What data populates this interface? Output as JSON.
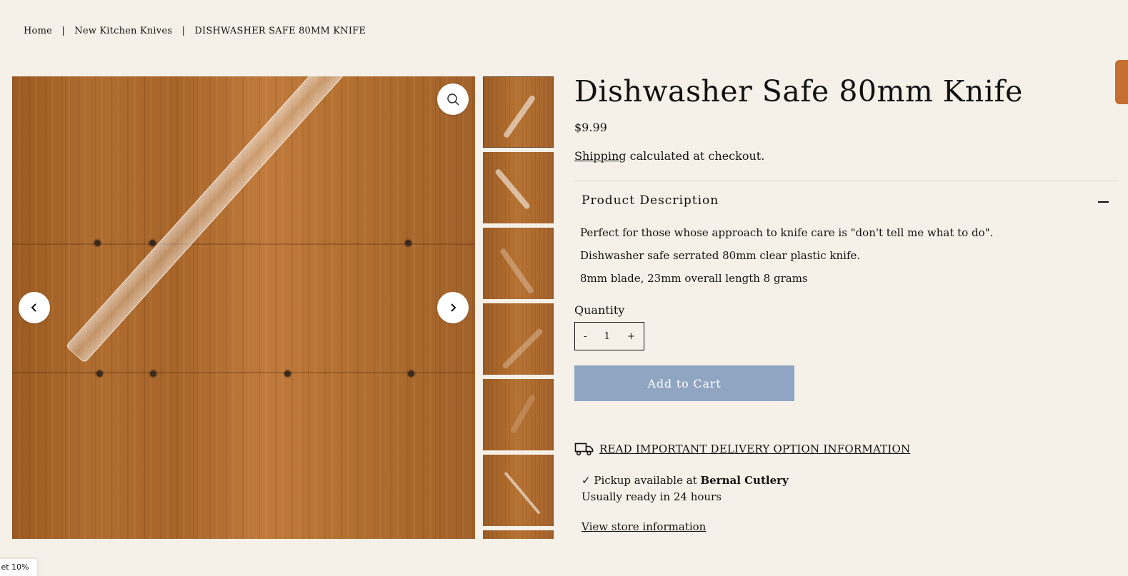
{
  "breadcrumb": {
    "home": "Home",
    "separator": "|",
    "category": "New Kitchen Knives",
    "current": "DISHWASHER SAFE 80MM KNIFE"
  },
  "gallery": {
    "zoom_icon": "magnifier-icon",
    "prev_icon": "chevron-left-icon",
    "next_icon": "chevron-right-icon",
    "thumbnail_count_visible": 7
  },
  "product": {
    "title": "Dishwasher Safe 80mm Knife",
    "price": "$9.99",
    "shipping_link": "Shipping",
    "shipping_text": " calculated at checkout."
  },
  "description": {
    "heading": "Product Description",
    "collapse_icon": "minus-icon",
    "lines": [
      "Perfect for those whose approach to knife care is \"don't tell me what to do\".",
      "Dishwasher safe serrated 80mm clear plastic knife.",
      "8mm blade, 23mm overall length 8 grams"
    ]
  },
  "quantity": {
    "label": "Quantity",
    "decrement": "-",
    "value": "1",
    "increment": "+"
  },
  "cart": {
    "add_label": "Add to Cart",
    "color": "#8fa5c2"
  },
  "delivery": {
    "icon": "truck-icon",
    "link": "READ IMPORTANT DELIVERY OPTION INFORMATION"
  },
  "pickup": {
    "check": "✓",
    "text": "Pickup available at ",
    "store": "Bernal Cutlery",
    "ready": "Usually ready in 24 hours",
    "store_link": "View store information"
  },
  "promo": {
    "text": "et 10%"
  }
}
